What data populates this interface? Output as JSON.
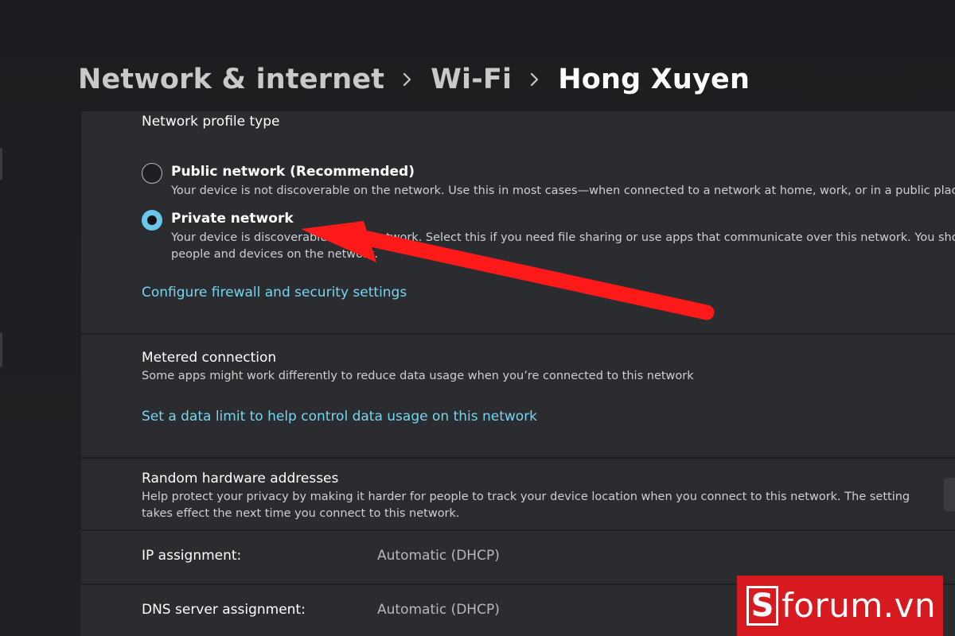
{
  "breadcrumb": {
    "items": [
      "Network & internet",
      "Wi-Fi",
      "Hong Xuyen"
    ]
  },
  "profile": {
    "title": "Network profile type",
    "options": [
      {
        "label": "Public network (Recommended)",
        "desc": "Your device is not discoverable on the network. Use this in most cases—when connected to a network at home, work, or in a public place.",
        "selected": false
      },
      {
        "label": "Private network",
        "desc_line1": "Your device is discoverable on the network. Select this if you need file sharing or use apps that communicate over this network. You should",
        "desc_line2": "people and devices on the network.",
        "selected": true
      }
    ],
    "firewall_link": "Configure firewall and security settings"
  },
  "metered": {
    "title": "Metered connection",
    "desc": "Some apps might work differently to reduce data usage when you’re connected to this network",
    "link": "Set a data limit to help control data usage on this network"
  },
  "random_hw": {
    "title": "Random hardware addresses",
    "desc_line1": "Help protect your privacy by making it harder for people to track your device location when you connect to this network. The setting",
    "desc_line2": "takes effect the next time you connect to this network."
  },
  "ip": {
    "label": "IP assignment:",
    "value": "Automatic (DHCP)"
  },
  "dns": {
    "label": "DNS server assignment:",
    "value": "Automatic (DHCP)"
  },
  "watermark": {
    "badge": "S",
    "text": "forum.vn"
  },
  "colors": {
    "link": "#76d4ee",
    "radio_accent": "#6cc6ec",
    "annotation_arrow": "#ff1a1a",
    "watermark_bg": "#d71920"
  },
  "icons": [
    "chevron-right-icon",
    "radio-unchecked-icon",
    "radio-checked-icon",
    "annotation-arrow-icon"
  ]
}
